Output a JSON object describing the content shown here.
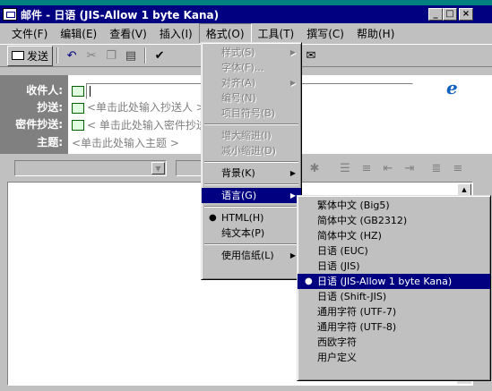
{
  "window": {
    "title": "邮件 - 日语 (JIS-Allow 1 byte Kana)",
    "controls": {
      "minimize": "_",
      "maximize": "□",
      "close": "×"
    }
  },
  "menubar": [
    {
      "label": "文件(F)"
    },
    {
      "label": "编辑(E)"
    },
    {
      "label": "查看(V)"
    },
    {
      "label": "插入(I)"
    },
    {
      "label": "格式(O)",
      "open": true
    },
    {
      "label": "工具(T)"
    },
    {
      "label": "撰写(C)"
    },
    {
      "label": "帮助(H)"
    }
  ],
  "toolbar": {
    "send_label": "发送"
  },
  "header": {
    "to_label": "收件人:",
    "cc_label": "抄送:",
    "bcc_label": "密件抄送:",
    "subject_label": "主题:",
    "cc_hint": "<单击此处输入抄送人 >",
    "bcc_hint": "< 单击此处输入密件抄送",
    "subject_hint": "<单击此处输入主题 >"
  },
  "format_menu": {
    "items": [
      {
        "label": "样式(S)",
        "disabled": true,
        "submenu": true
      },
      {
        "label": "字体(F)...",
        "disabled": true
      },
      {
        "label": "对齐(A)",
        "disabled": true,
        "submenu": true
      },
      {
        "label": "编号(N)",
        "disabled": true
      },
      {
        "label": "项目符号(B)",
        "disabled": true
      },
      {
        "sep": true
      },
      {
        "label": "增大缩进(I)",
        "disabled": true
      },
      {
        "label": "减小缩进(D)",
        "disabled": true
      },
      {
        "sep": true
      },
      {
        "label": "背景(K)",
        "submenu": true
      },
      {
        "sep": true
      },
      {
        "label": "语言(G)",
        "submenu": true,
        "selected": true
      },
      {
        "sep": true
      },
      {
        "label": "HTML(H)",
        "checked": true
      },
      {
        "label": "纯文本(P)"
      },
      {
        "sep": true
      },
      {
        "label": "使用信纸(L)",
        "submenu": true
      }
    ]
  },
  "language_menu": {
    "items": [
      {
        "label": "繁体中文 (Big5)"
      },
      {
        "label": "简体中文 (GB2312)"
      },
      {
        "label": "简体中文 (HZ)"
      },
      {
        "label": "日语 (EUC)"
      },
      {
        "label": "日语 (JIS)"
      },
      {
        "label": "日语 (JIS-Allow 1 byte Kana)",
        "checked": true,
        "selected": true
      },
      {
        "label": "日语 (Shift-JIS)"
      },
      {
        "label": "通用字符 (UTF-7)"
      },
      {
        "label": "通用字符 (UTF-8)"
      },
      {
        "label": "西欧字符"
      },
      {
        "label": "用户定义"
      }
    ]
  }
}
